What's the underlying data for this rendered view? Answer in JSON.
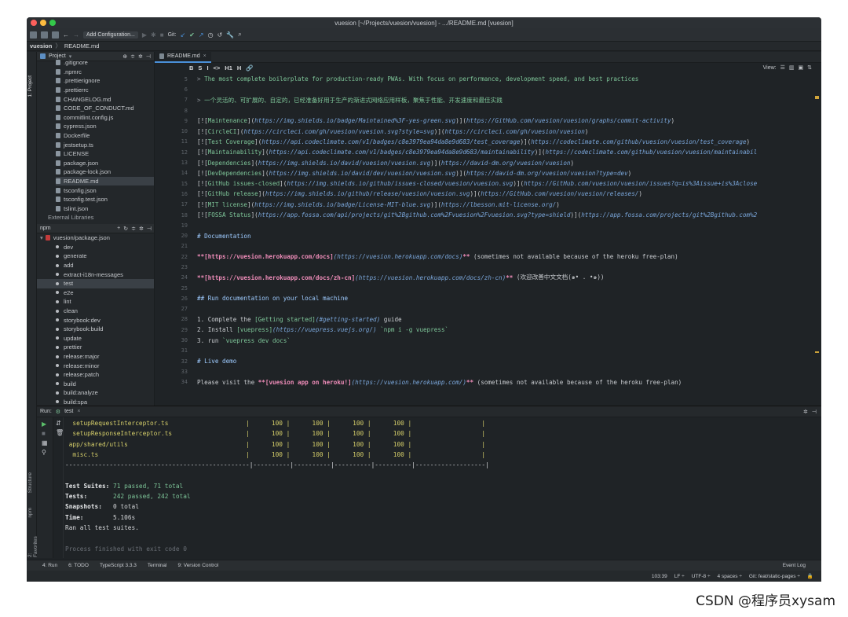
{
  "window": {
    "title": "vuesion [~/Projects/vuesion/vuesion] - .../README.md [vuesion]"
  },
  "toolbar": {
    "add_config": "Add Configuration...",
    "git_label": "Git:"
  },
  "navbar": {
    "project": "vuesion",
    "file": "README.md"
  },
  "left_strip": {
    "tab1": "1: Project",
    "tab2": "Structure",
    "tab3": "npm",
    "tab4": "2: Favorites"
  },
  "project_panel": {
    "header": "Project",
    "files": [
      ".gitignore",
      ".npmrc",
      ".prettierignore",
      ".prettierrc",
      "CHANGELOG.md",
      "CODE_OF_CONDUCT.md",
      "commitlint.config.js",
      "cypress.json",
      "Dockerfile",
      "jestsetup.ts",
      "LICENSE",
      "package.json",
      "package-lock.json",
      "README.md",
      "tsconfig.json",
      "tsconfig.test.json",
      "tslint.json"
    ],
    "external": "External Libraries"
  },
  "npm_panel": {
    "header": "npm",
    "root": "vuesion/package.json",
    "scripts": [
      "dev",
      "generate",
      "add",
      "extract-i18n-messages",
      "test",
      "e2e",
      "lint",
      "clean",
      "storybook:dev",
      "storybook:build",
      "update",
      "prettier",
      "release:major",
      "release:minor",
      "release:patch",
      "build",
      "build:analyze",
      "build:spa"
    ]
  },
  "editor": {
    "tab": "README.md",
    "view_label": "View:",
    "md_toolbar": [
      "B",
      "S",
      "I",
      "<>",
      "H1",
      "H",
      "🔗"
    ],
    "lines": [
      {
        "n": "5",
        "segs": [
          [
            "gray",
            "> "
          ],
          [
            "green",
            "The most complete boilerplate for production-ready PWAs. With focus on performance, development speed, and best practices"
          ]
        ]
      },
      {
        "n": "6",
        "segs": []
      },
      {
        "n": "7",
        "segs": [
          [
            "gray",
            "> "
          ],
          [
            "green",
            "一个灵活的、可扩展的、自定的，已经准备好用于生产的渐进式网络应用样板，聚焦于性能、开发速度和最佳实践"
          ]
        ]
      },
      {
        "n": "8",
        "segs": []
      },
      {
        "n": "9",
        "segs": [
          [
            "txt",
            "[!["
          ],
          [
            "green",
            "Maintenance"
          ],
          [
            "txt",
            "]("
          ],
          [
            "ital",
            "https://img.shields.io/badge/Maintained%3F-yes-green.svg"
          ],
          [
            "txt",
            ")]("
          ],
          [
            "ital",
            "https://GitHub.com/vuesion/vuesion/graphs/commit-activity"
          ],
          [
            "txt",
            ")"
          ]
        ]
      },
      {
        "n": "10",
        "segs": [
          [
            "txt",
            "[!["
          ],
          [
            "green",
            "CircleCI"
          ],
          [
            "txt",
            "]("
          ],
          [
            "ital",
            "https://circleci.com/gh/vuesion/vuesion.svg?style=svg"
          ],
          [
            "txt",
            ")]("
          ],
          [
            "ital",
            "https://circleci.com/gh/vuesion/vuesion"
          ],
          [
            "txt",
            ")"
          ]
        ]
      },
      {
        "n": "11",
        "segs": [
          [
            "txt",
            "[!["
          ],
          [
            "green",
            "Test Coverage"
          ],
          [
            "txt",
            "]("
          ],
          [
            "ital",
            "https://api.codeclimate.com/v1/badges/c8e3979ea94da8e9d683/test_coverage"
          ],
          [
            "txt",
            ")]("
          ],
          [
            "ital",
            "https://codeclimate.com/github/vuesion/vuesion/test_coverage"
          ],
          [
            "txt",
            ")"
          ]
        ]
      },
      {
        "n": "12",
        "segs": [
          [
            "txt",
            "[!["
          ],
          [
            "green",
            "Maintainability"
          ],
          [
            "txt",
            "]("
          ],
          [
            "ital",
            "https://api.codeclimate.com/v1/badges/c8e3979ea94da8e9d683/maintainability"
          ],
          [
            "txt",
            ")]("
          ],
          [
            "ital",
            "https://codeclimate.com/github/vuesion/vuesion/maintainabil"
          ]
        ]
      },
      {
        "n": "13",
        "segs": [
          [
            "txt",
            "[!["
          ],
          [
            "green",
            "Dependencies"
          ],
          [
            "txt",
            "]("
          ],
          [
            "ital",
            "https://img.shields.io/david/vuesion/vuesion.svg"
          ],
          [
            "txt",
            ")]("
          ],
          [
            "ital",
            "https://david-dm.org/vuesion/vuesion"
          ],
          [
            "txt",
            ")"
          ]
        ]
      },
      {
        "n": "14",
        "segs": [
          [
            "txt",
            "[!["
          ],
          [
            "green",
            "DevDependencies"
          ],
          [
            "txt",
            "]("
          ],
          [
            "ital",
            "https://img.shields.io/david/dev/vuesion/vuesion.svg"
          ],
          [
            "txt",
            ")]("
          ],
          [
            "ital",
            "https://david-dm.org/vuesion/vuesion?type=dev"
          ],
          [
            "txt",
            ")"
          ]
        ]
      },
      {
        "n": "15",
        "segs": [
          [
            "txt",
            "[!["
          ],
          [
            "green",
            "GitHub issues-closed"
          ],
          [
            "txt",
            "]("
          ],
          [
            "ital",
            "https://img.shields.io/github/issues-closed/vuesion/vuesion.svg"
          ],
          [
            "txt",
            ")]("
          ],
          [
            "ital",
            "https://GitHub.com/vuesion/vuesion/issues?q=is%3Aissue+is%3Aclose"
          ]
        ]
      },
      {
        "n": "16",
        "segs": [
          [
            "txt",
            "[!["
          ],
          [
            "green",
            "GitHub release"
          ],
          [
            "txt",
            "]("
          ],
          [
            "ital",
            "https://img.shields.io/github/release/vuesion/vuesion.svg"
          ],
          [
            "txt",
            ")]("
          ],
          [
            "ital",
            "https://GitHub.com/vuesion/vuesion/releases/"
          ],
          [
            "txt",
            ")"
          ]
        ]
      },
      {
        "n": "17",
        "segs": [
          [
            "txt",
            "[!["
          ],
          [
            "green",
            "MIT license"
          ],
          [
            "txt",
            "]("
          ],
          [
            "ital",
            "https://img.shields.io/badge/License-MIT-blue.svg"
          ],
          [
            "txt",
            ")]("
          ],
          [
            "ital",
            "https://lbesson.mit-license.org/"
          ],
          [
            "txt",
            ")"
          ]
        ]
      },
      {
        "n": "18",
        "segs": [
          [
            "txt",
            "[!["
          ],
          [
            "green",
            "FOSSA Status"
          ],
          [
            "txt",
            "]("
          ],
          [
            "ital",
            "https://app.fossa.com/api/projects/git%2Bgithub.com%2Fvuesion%2Fvuesion.svg?type=shield"
          ],
          [
            "txt",
            ")]("
          ],
          [
            "ital",
            "https://app.fossa.com/projects/git%2Bgithub.com%2"
          ]
        ]
      },
      {
        "n": "19",
        "segs": []
      },
      {
        "n": "20",
        "segs": [
          [
            "blue",
            "# Documentation"
          ]
        ]
      },
      {
        "n": "21",
        "segs": []
      },
      {
        "n": "22",
        "segs": [
          [
            "pink",
            "**[https://vuesion.herokuapp.com/docs]"
          ],
          [
            "ital",
            "(https://vuesion.herokuapp.com/docs)"
          ],
          [
            "pink",
            "**"
          ],
          [
            "txt",
            " (sometimes not available because of the heroku free-plan)"
          ]
        ]
      },
      {
        "n": "23",
        "segs": []
      },
      {
        "n": "24",
        "segs": [
          [
            "pink",
            "**[https://vuesion.herokuapp.com/docs/zh-cn]"
          ],
          [
            "ital",
            "(https://vuesion.herokuapp.com/docs/zh-cn)"
          ],
          [
            "pink",
            "**"
          ],
          [
            "txt",
            " (欢迎改善中文文档(๑• . •๑))"
          ]
        ]
      },
      {
        "n": "25",
        "segs": []
      },
      {
        "n": "26",
        "segs": [
          [
            "blue",
            "## Run documentation on your local machine"
          ]
        ]
      },
      {
        "n": "27",
        "segs": []
      },
      {
        "n": "28",
        "segs": [
          [
            "txt",
            "1. Complete the "
          ],
          [
            "green",
            "[Getting started]"
          ],
          [
            "ital",
            "(#getting-started)"
          ],
          [
            "txt",
            " guide"
          ]
        ]
      },
      {
        "n": "29",
        "segs": [
          [
            "txt",
            "2. Install "
          ],
          [
            "green",
            "[vuepress]"
          ],
          [
            "ital",
            "(https://vuepress.vuejs.org/)"
          ],
          [
            "txt",
            " "
          ],
          [
            "green",
            "`npm i -g vuepress`"
          ]
        ]
      },
      {
        "n": "30",
        "segs": [
          [
            "txt",
            "3. run "
          ],
          [
            "green",
            "`vuepress dev docs`"
          ]
        ]
      },
      {
        "n": "31",
        "segs": []
      },
      {
        "n": "32",
        "segs": [
          [
            "blue",
            "# Live demo"
          ]
        ]
      },
      {
        "n": "33",
        "segs": []
      },
      {
        "n": "34",
        "segs": [
          [
            "txt",
            "Please visit the "
          ],
          [
            "pink",
            "**[vuesion app on heroku!]"
          ],
          [
            "ital",
            "(https://vuesion.herokuapp.com/)"
          ],
          [
            "pink",
            "**"
          ],
          [
            "txt",
            " (sometimes not available because of the heroku free-plan)"
          ]
        ]
      }
    ]
  },
  "run_panel": {
    "label": "Run:",
    "tab": "test",
    "output": "  setupRequestInterceptor.ts                     |      100 |      100 |      100 |      100 |                   |\n  setupResponseInterceptor.ts                    |      100 |      100 |      100 |      100 |                   |\n app/shared/utils                                |      100 |      100 |      100 |      100 |                   |\n  misc.ts                                        |      100 |      100 |      100 |      100 |                   |\n--------------------------------------------------|----------|----------|----------|----------|-------------------|\n\nTest Suites: 71 passed, 71 total\nTests:       242 passed, 242 total\nSnapshots:   0 total\nTime:        5.106s\nRan all test suites.\n\nProcess finished with exit code 0"
  },
  "bottom_tabs": [
    "4: Run",
    "6: TODO",
    "TypeScript 3.3.3",
    "Terminal",
    "9: Version Control"
  ],
  "event_log": "Event Log",
  "status": {
    "position": "103:39",
    "line_sep": "LF ÷",
    "encoding": "UTF-8 ÷",
    "indent": "4 spaces ÷",
    "git": "Git: feat/static-pages ÷"
  },
  "watermark": "CSDN @程序员xysam",
  "colors": {
    "bg": "#1f2326",
    "accent": "#4a90d9",
    "green": "#7ec699",
    "pink": "#f08dba"
  }
}
